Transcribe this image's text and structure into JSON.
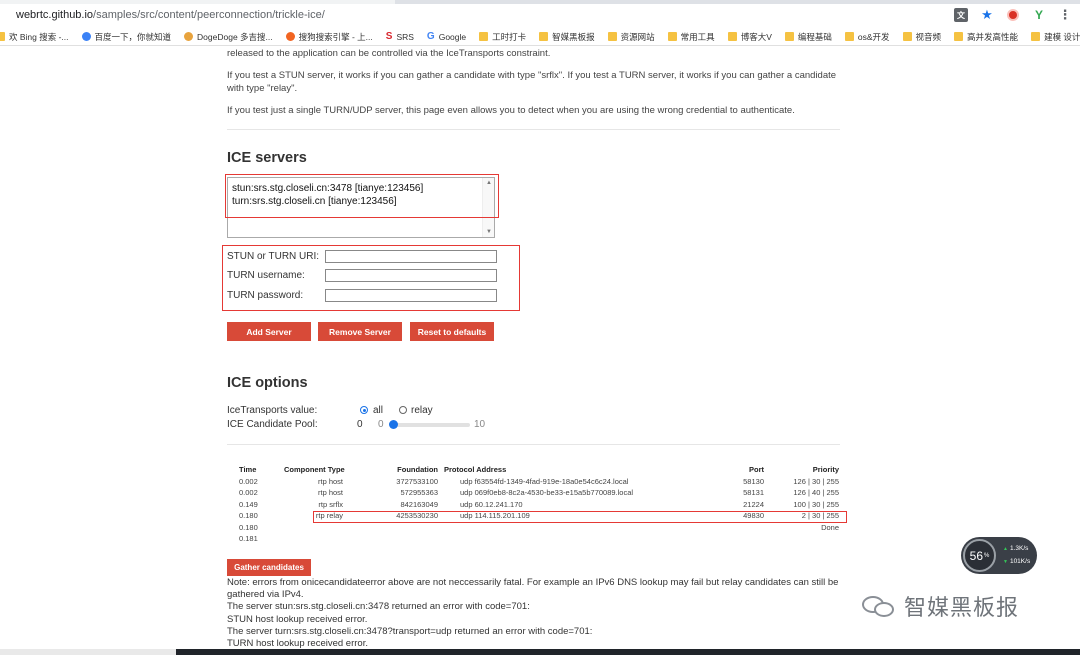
{
  "browser": {
    "url_host": "webrtc.github.io",
    "url_path": "/samples/src/content/peerconnection/trickle-ice/"
  },
  "bookmarks": [
    {
      "label": "欢 Bing 搜索 -...",
      "icon": "folder-icon"
    },
    {
      "label": "百度一下，你就知道",
      "icon": "paw-icon"
    },
    {
      "label": "DogeDoge 多吉搜...",
      "icon": "doge-icon"
    },
    {
      "label": "搜狗搜索引擎 - 上...",
      "icon": "sogou-icon"
    },
    {
      "label": "SRS",
      "icon": "s-icon"
    },
    {
      "label": "Google",
      "icon": "google-icon"
    },
    {
      "label": "工时打卡",
      "icon": "folder-icon"
    },
    {
      "label": "智媒黑板报",
      "icon": "folder-icon"
    },
    {
      "label": "资源网站",
      "icon": "folder-icon"
    },
    {
      "label": "常用工具",
      "icon": "folder-icon"
    },
    {
      "label": "博客大V",
      "icon": "folder-icon"
    },
    {
      "label": "编程基础",
      "icon": "folder-icon"
    },
    {
      "label": "os&开发",
      "icon": "folder-icon"
    },
    {
      "label": "视音频",
      "icon": "folder-icon"
    },
    {
      "label": "高并发高性能",
      "icon": "folder-icon"
    },
    {
      "label": "建模 设计和测试",
      "icon": "folder-icon"
    },
    {
      "label": "分",
      "icon": "folder-icon"
    }
  ],
  "intro": {
    "p0": "released to the application can be controlled via the IceTransports constraint.",
    "p1": "If you test a STUN server, it works if you can gather a candidate with type \"srflx\". If you test a TURN server, it works if you can gather a candidate with type \"relay\".",
    "p2": "If you test just a single TURN/UDP server, this page even allows you to detect when you are using the wrong credential to authenticate."
  },
  "ice_servers": {
    "heading": "ICE servers",
    "list": [
      "stun:srs.stg.closeli.cn:3478 [tianye:123456]",
      "turn:srs.stg.closeli.cn [tianye:123456]"
    ],
    "uri_label": "STUN or TURN URI:",
    "username_label": "TURN username:",
    "password_label": "TURN password:",
    "uri_value": "",
    "username_value": "",
    "password_value": "",
    "add_button": "Add Server",
    "remove_button": "Remove Server",
    "reset_button": "Reset to defaults"
  },
  "ice_options": {
    "heading": "ICE options",
    "transports_label": "IceTransports value:",
    "radio_all": "all",
    "radio_relay": "relay",
    "pool_label": "ICE Candidate Pool:",
    "pool_value": "0",
    "pool_min": "0",
    "pool_max": "10",
    "pool_fraction": 0.0
  },
  "candidates": {
    "headers": {
      "time": "Time",
      "component": "Component Type",
      "foundation": "Foundation",
      "protocol": "Protocol Address",
      "port": "Port",
      "priority": "Priority"
    },
    "rows": [
      {
        "time": "0.002",
        "component": "rtp host",
        "foundation": "3727533100",
        "protocol": "udp f63554fd-1349-4fad-919e-18a0e54c6c24.local",
        "port": "58130",
        "priority": "126 | 30 | 255"
      },
      {
        "time": "0.002",
        "component": "rtp host",
        "foundation": "572955363",
        "protocol": "udp 069f0eb8-8c2a-4530-be33-e15a5b770089.local",
        "port": "58131",
        "priority": "126 | 40 | 255"
      },
      {
        "time": "0.149",
        "component": "rtp srflx",
        "foundation": "842163049",
        "protocol": "udp 60.12.241.170",
        "port": "21224",
        "priority": "100 | 30 | 255"
      },
      {
        "time": "0.180",
        "component": "rtp relay",
        "foundation": "4253530230",
        "protocol": "udp 114.115.201.109",
        "port": "49830",
        "priority": "2 | 30 | 255"
      },
      {
        "time": "0.180",
        "component": "",
        "foundation": "",
        "protocol": "",
        "port": "",
        "priority": "Done"
      },
      {
        "time": "0.181",
        "component": "",
        "foundation": "",
        "protocol": "",
        "port": "",
        "priority": ""
      }
    ],
    "gather_button": "Gather candidates"
  },
  "notes": [
    "Note: errors from onicecandidateerror above are not neccessarily fatal. For example an IPv6 DNS lookup may fail but relay candidates can still be gathered via IPv4.",
    "The server stun:srs.stg.closeli.cn:3478 returned an error with code=701:",
    "STUN host lookup received error.",
    "The server turn:srs.stg.closeli.cn:3478?transport=udp returned an error with code=701:",
    "TURN host lookup received error."
  ],
  "speed_widget": {
    "percent": "56",
    "percent_unit": "%",
    "up": "1.3K/s",
    "down": "101K/s"
  },
  "watermark": {
    "text": "智媒黑板报"
  },
  "colors": {
    "button_red": "#d84a38",
    "annotation_red": "#e53935",
    "accent_blue": "#1a73e8"
  }
}
